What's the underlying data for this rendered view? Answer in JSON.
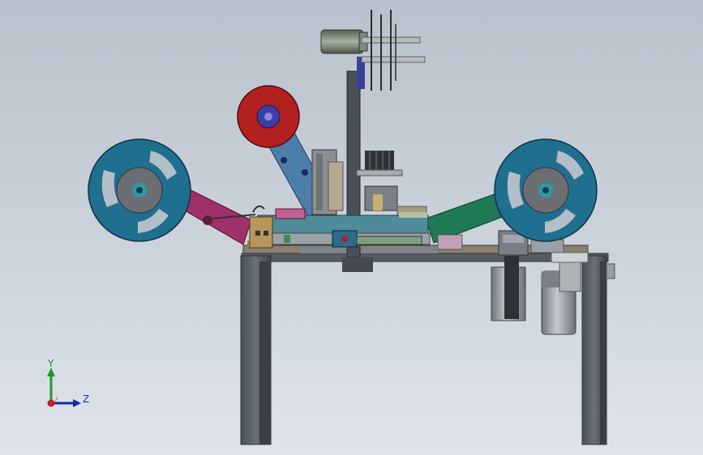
{
  "scene": {
    "colors": {
      "background_top": "#b9c1cc",
      "background_bottom": "#dfe4ea",
      "frame": "#5a6068",
      "frame_dark": "#3e444b",
      "reel_blue": "#1f6f8f",
      "reel_hub": "#6b6e72",
      "reel_red": "#b22020",
      "reel_red_hub": "#3e3ea8",
      "arm_magenta": "#a0306a",
      "arm_green": "#1e7a55",
      "arm_blue": "#4b7eab",
      "plate_teal": "#4f8c9a",
      "plate_tan": "#b09a7a",
      "motor_green": "#6e7a6a",
      "cylinder_grey": "#8a9097"
    }
  },
  "triad": {
    "y_label": "Y",
    "z_label": "Z",
    "y_color": "#1a9a2a",
    "z_color": "#1a2aa8",
    "x_color": "#c0202a"
  }
}
